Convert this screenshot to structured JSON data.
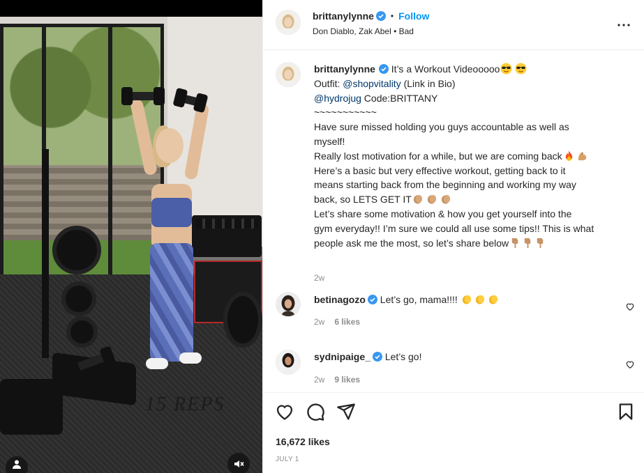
{
  "media": {
    "overlay_text": "15 REPS",
    "icons": {
      "user_tag": "user-tag-icon",
      "sound": "muted-speaker-icon"
    }
  },
  "header": {
    "username": "brittanylynne",
    "separator": "•",
    "follow_label": "Follow",
    "audio": "Don Diablo, Zak Abel • Bad",
    "icons": {
      "verified": "verified-badge-icon",
      "more": "more-options-icon"
    }
  },
  "caption": {
    "username": "brittanylynne",
    "line1_text": "It’s a Workout Videooooo",
    "line2_prefix": "Outfit: ",
    "line2_mention": "@shopvitality",
    "line2_suffix": " (Link in Bio)",
    "line3_mention": "@hydrojug",
    "line3_suffix": " Code:BRITTANY",
    "line4": "~~~~~~~~~~~",
    "line5": "Have sure missed holding you guys accountable as well as",
    "line6": "myself!",
    "line7": "Really lost motivation for a while, but we are coming back",
    "line8": "Here’s a basic but very effective workout, getting back to it",
    "line9": "means starting back from the beginning and working my way",
    "line10": "back, so LETS GET IT",
    "line11": "Let’s share some motivation & how you get yourself into the",
    "line12": "gym everyday!! I’m sure we could all use some tips!! This is what",
    "line13": "people ask me the most, so let’s share below",
    "time": "2w",
    "emojis": [
      "sunglasses-face",
      "sunglasses-face",
      "fire",
      "flexed-biceps",
      "clapping-hands",
      "clapping-hands",
      "clapping-hands",
      "backhand-index-pointing-down",
      "backhand-index-pointing-down",
      "backhand-index-pointing-down"
    ]
  },
  "comments": [
    {
      "username": "betinagozo",
      "text": "Let’s go, mama!!!! ",
      "time": "2w",
      "likes": "6 likes",
      "emojis": [
        "clapping-hands",
        "clapping-hands",
        "clapping-hands"
      ]
    },
    {
      "username": "sydnipaige_",
      "text": "Let’s go!",
      "time": "2w",
      "likes": "9 likes",
      "emojis": []
    }
  ],
  "actions": {
    "likes": "16,672 likes",
    "date": "JULY 1",
    "icons": {
      "like": "heart-icon",
      "comment": "comment-bubble-icon",
      "share": "paper-plane-icon",
      "save": "bookmark-icon"
    }
  },
  "colors": {
    "link": "#0095f6",
    "mention": "#00376b",
    "muted": "#8e8e8e",
    "text": "#262626",
    "verified": "#3897f0"
  }
}
